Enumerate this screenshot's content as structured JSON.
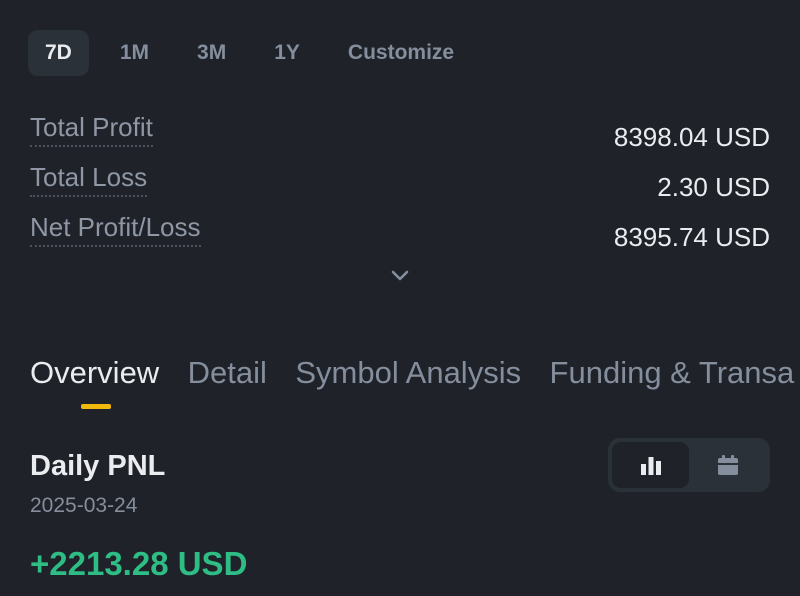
{
  "period_tabs": [
    {
      "label": "7D",
      "active": true
    },
    {
      "label": "1M",
      "active": false
    },
    {
      "label": "3M",
      "active": false
    },
    {
      "label": "1Y",
      "active": false
    },
    {
      "label": "Customize",
      "active": false
    }
  ],
  "stats": [
    {
      "label": "Total Profit",
      "value": "8398.04 USD"
    },
    {
      "label": "Total Loss",
      "value": "2.30 USD"
    },
    {
      "label": "Net Profit/Loss",
      "value": "8395.74 USD"
    }
  ],
  "main_tabs": [
    {
      "label": "Overview",
      "active": true
    },
    {
      "label": "Detail",
      "active": false
    },
    {
      "label": "Symbol Analysis",
      "active": false
    },
    {
      "label": "Funding & Transa",
      "active": false
    }
  ],
  "daily_pnl": {
    "title": "Daily PNL",
    "date": "2025-03-24",
    "value": "+2213.28 USD"
  },
  "icons": {
    "expand": "chevron-down-icon",
    "chart_view": "bar-chart-icon",
    "calendar_view": "calendar-icon"
  },
  "colors": {
    "background": "#1f2229",
    "accent": "#f0b90b",
    "positive": "#2ebd85"
  }
}
